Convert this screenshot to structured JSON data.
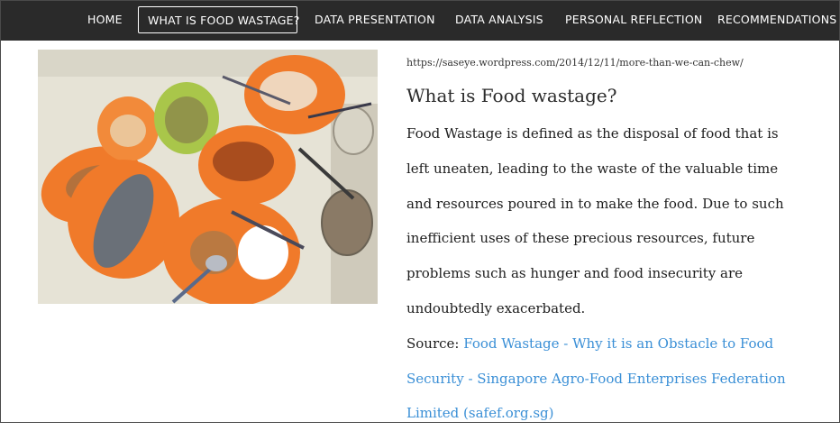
{
  "nav": {
    "items": [
      {
        "label": "HOME"
      },
      {
        "label": "WHAT IS FOOD WASTAGE?"
      },
      {
        "label": "DATA PRESENTATION"
      },
      {
        "label": "DATA ANALYSIS"
      },
      {
        "label": "PERSONAL REFLECTION"
      },
      {
        "label": "RECOMMENDATIONS"
      }
    ]
  },
  "article": {
    "image_credit_url": "https://saseye.wordpress.com/2014/12/11/more-than-we-can-chew/",
    "heading": "What is Food wastage?",
    "paragraph": "Food Wastage is defined as the disposal of food that is left uneaten, leading to the waste of the valuable time and resources poured in to make the food. Due to such inefficient uses of these precious resources, future problems such as hunger and food insecurity are undoubtedly exacerbated.",
    "source_label": "Source:",
    "source_link_text": "Food Wastage - Why it is an Obstacle to Food Security - Singapore Agro-Food Enterprises Federation Limited (safef.org.sg)"
  },
  "colors": {
    "nav_bg": "#2a2a2a",
    "link": "#3a8fd6",
    "plate_orange": "#f07a2a",
    "plate_green": "#a9c64a"
  }
}
